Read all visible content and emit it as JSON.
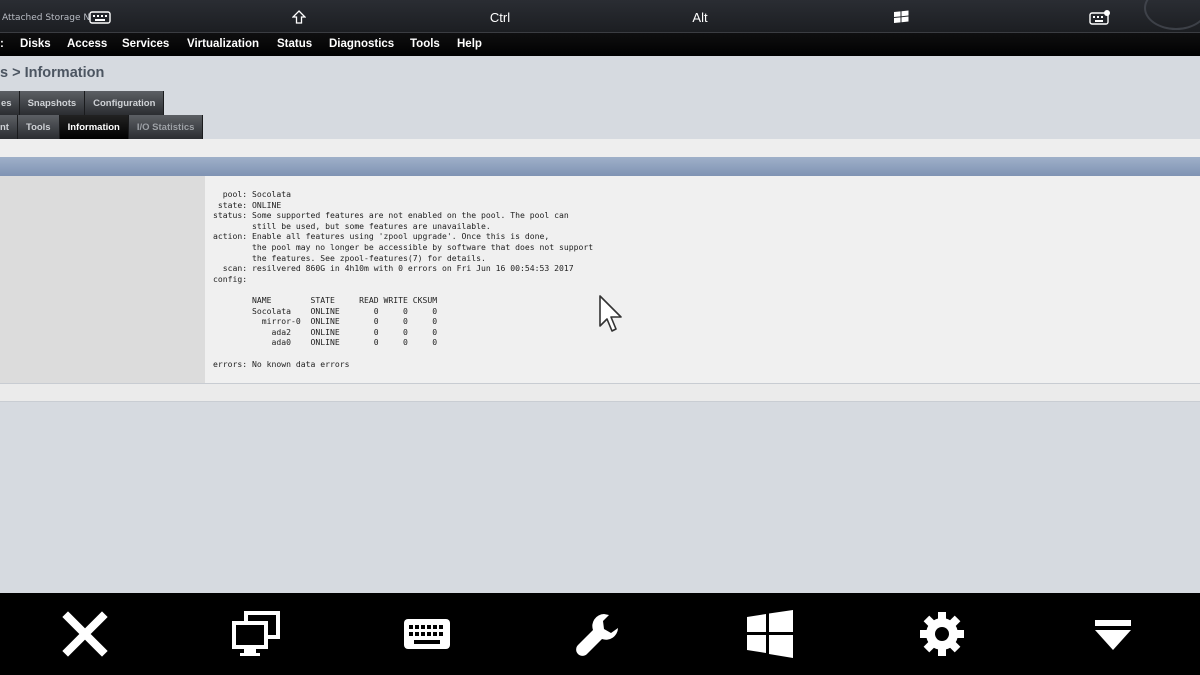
{
  "topbar": {
    "brand_text": "Attached Storage N",
    "ctrl_label": "Ctrl",
    "alt_label": "Alt",
    "icons": [
      "keyboard-icon",
      "shift-icon",
      "windows-icon",
      "keyboard-settings-icon"
    ]
  },
  "menu": {
    "items": [
      {
        "label": ":"
      },
      {
        "label": "Disks"
      },
      {
        "label": "Access"
      },
      {
        "label": "Services"
      },
      {
        "label": "Virtualization"
      },
      {
        "label": "Status"
      },
      {
        "label": "Diagnostics"
      },
      {
        "label": "Tools"
      },
      {
        "label": "Help"
      }
    ]
  },
  "page": {
    "title": "s > Information"
  },
  "tabs_row1": [
    {
      "label": "es",
      "state": "normal"
    },
    {
      "label": "Snapshots",
      "state": "normal"
    },
    {
      "label": "Configuration",
      "state": "normal"
    }
  ],
  "tabs_row2": [
    {
      "label": "nt",
      "state": "normal"
    },
    {
      "label": "Tools",
      "state": "normal"
    },
    {
      "label": "Information",
      "state": "active"
    },
    {
      "label": "I/O Statistics",
      "state": "dim"
    }
  ],
  "zpool_output": "  pool: Socolata\n state: ONLINE\nstatus: Some supported features are not enabled on the pool. The pool can\n        still be used, but some features are unavailable.\naction: Enable all features using 'zpool upgrade'. Once this is done,\n        the pool may no longer be accessible by software that does not support\n        the features. See zpool-features(7) for details.\n  scan: resilvered 860G in 4h10m with 0 errors on Fri Jun 16 00:54:53 2017\nconfig:\n\n        NAME        STATE     READ WRITE CKSUM\n        Socolata    ONLINE       0     0     0\n          mirror-0  ONLINE       0     0     0\n            ada2    ONLINE       0     0     0\n            ada0    ONLINE       0     0     0\n\nerrors: No known data errors",
  "bottombar": {
    "icons": [
      "close-icon",
      "monitors-icon",
      "keyboard-icon",
      "wrench-icon",
      "windows-icon",
      "gear-icon",
      "collapse-icon"
    ]
  },
  "colors": {
    "menubar": "#000000",
    "blue_header": "#8a9dbb",
    "content_bg": "#d6dae0",
    "panel_bg": "#f0f0f0"
  }
}
